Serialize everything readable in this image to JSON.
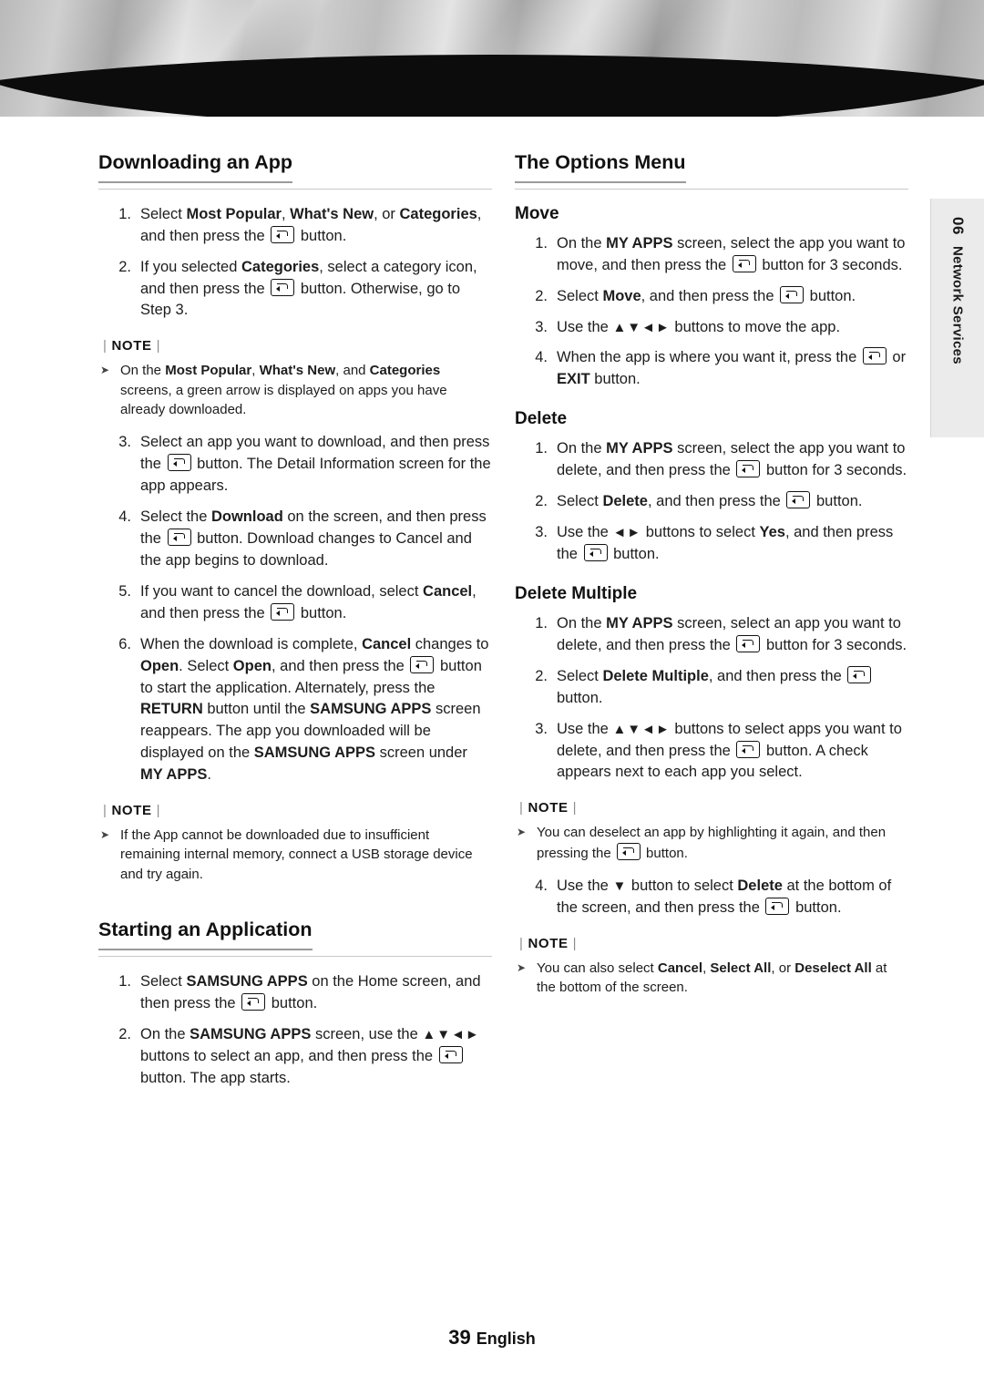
{
  "page": {
    "number": "39",
    "language": "English",
    "side_tab_number": "06",
    "side_tab_label": "Network Services"
  },
  "left_column": {
    "section_title": "Downloading an App",
    "steps": [
      {
        "num": "1.",
        "html": "Select <b>Most Popular</b>, <b>What's New</b>, or <b>Categories</b>, and then press the <span class=\"ekey\"></span> button."
      },
      {
        "num": "2.",
        "html": "If you selected <b>Categories</b>, select a category icon, and then press the <span class=\"ekey\"></span> button. Otherwise, go to Step 3."
      }
    ],
    "note1": {
      "head": "NOTE",
      "items": [
        "On the <b>Most Popular</b>, <b>What's New</b>, and <b>Categories</b> screens, a green arrow is displayed on apps you have already downloaded."
      ]
    },
    "steps2": [
      {
        "num": "3.",
        "html": "Select an app you want to download, and then press the <span class=\"ekey\"></span> button. The Detail Information screen for the app appears."
      },
      {
        "num": "4.",
        "html": "Select the <b>Download</b> on the screen, and then press the <span class=\"ekey\"></span> button. Download changes to Cancel and the app begins to download."
      },
      {
        "num": "5.",
        "html": "If you want to cancel the download, select <b>Cancel</b>, and then press the <span class=\"ekey\"></span> button."
      },
      {
        "num": "6.",
        "html": "When the download is complete, <b>Cancel</b> changes to <b>Open</b>. Select <b>Open</b>, and then press the <span class=\"ekey\"></span> button to start the application. Alternately, press the <b>RETURN</b> button until the <b>SAMSUNG APPS</b> screen reappears. The app you downloaded will be displayed on the <b>SAMSUNG APPS</b> screen under <b>MY APPS</b>."
      }
    ],
    "note2": {
      "head": "NOTE",
      "items": [
        "If the App cannot be downloaded due to insufficient remaining internal memory, connect a USB storage device and try again."
      ]
    },
    "section_title2": "Starting an Application",
    "steps3": [
      {
        "num": "1.",
        "html": "Select <b>SAMSUNG APPS</b> on the Home screen, and then press the <span class=\"ekey\"></span> button."
      },
      {
        "num": "2.",
        "html": "On the <b>SAMSUNG APPS</b> screen, use the <span class=\"arrows\">▲▼◄►</span> buttons to select an app, and then press the <span class=\"ekey\"></span> button. The app starts."
      }
    ]
  },
  "right_column": {
    "section_title": "The Options Menu",
    "move": {
      "title": "Move",
      "steps": [
        {
          "num": "1.",
          "html": "On the <b>MY APPS</b> screen, select the app you want to move, and then press the <span class=\"ekey\"></span> button for 3 seconds."
        },
        {
          "num": "2.",
          "html": "Select <b>Move</b>, and then press the <span class=\"ekey\"></span> button."
        },
        {
          "num": "3.",
          "html": "Use the <span class=\"arrows\">▲▼◄►</span> buttons to move the app."
        },
        {
          "num": "4.",
          "html": "When the app is where you want it, press the <span class=\"ekey\"></span> or <b>EXIT</b> button."
        }
      ]
    },
    "delete": {
      "title": "Delete",
      "steps": [
        {
          "num": "1.",
          "html": "On the <b>MY APPS</b> screen, select the app you want to delete, and then press the <span class=\"ekey\"></span> button for 3 seconds."
        },
        {
          "num": "2.",
          "html": "Select <b>Delete</b>, and then press the <span class=\"ekey\"></span> button."
        },
        {
          "num": "3.",
          "html": "Use the <span class=\"arrows\">◄►</span> buttons to select <b>Yes</b>, and then press the <span class=\"ekey\"></span> button."
        }
      ]
    },
    "delete_multiple": {
      "title": "Delete Multiple",
      "steps": [
        {
          "num": "1.",
          "html": "On the <b>MY APPS</b> screen, select an app you want to delete, and then press the <span class=\"ekey\"></span> button for 3 seconds."
        },
        {
          "num": "2.",
          "html": "Select <b>Delete Multiple</b>, and then press the <span class=\"ekey\"></span> button."
        },
        {
          "num": "3.",
          "html": "Use the <span class=\"arrows\">▲▼◄►</span> buttons to select apps you want to delete, and then press the <span class=\"ekey\"></span> button. A check appears next to each app you select."
        }
      ],
      "note1": {
        "head": "NOTE",
        "items": [
          "You can deselect an app by highlighting it again, and then pressing the <span class=\"ekey\"></span> button."
        ]
      },
      "steps_after": [
        {
          "num": "4.",
          "html": "Use the <span class=\"arrows\">▼</span> button to select <b>Delete</b> at the bottom of the screen, and then press the <span class=\"ekey\"></span> button."
        }
      ],
      "note2": {
        "head": "NOTE",
        "items": [
          "You can also select <b>Cancel</b>, <b>Select All</b>, or <b>Deselect All</b> at the bottom of the screen."
        ]
      }
    }
  }
}
